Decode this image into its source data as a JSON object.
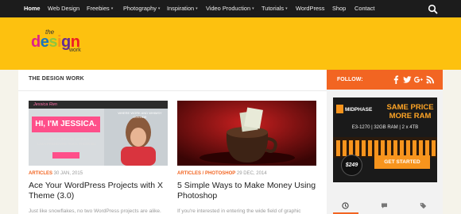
{
  "nav": {
    "items": [
      {
        "label": "Home",
        "caret": false,
        "active": true
      },
      {
        "label": "Web Design",
        "caret": false
      },
      {
        "label": "Freebies",
        "caret": true
      },
      {
        "label": "Photography",
        "caret": true
      },
      {
        "label": "Inspiration",
        "caret": true
      },
      {
        "label": "Video Production",
        "caret": true
      },
      {
        "label": "Tutorials",
        "caret": true
      },
      {
        "label": "WordPress",
        "caret": false
      },
      {
        "label": "Shop",
        "caret": false
      },
      {
        "label": "Contact",
        "caret": false
      }
    ],
    "caret_glyph": "▾",
    "search_icon": "search-icon"
  },
  "logo": {
    "the": "the",
    "design_letters": [
      "d",
      "e",
      "s",
      "i",
      "g",
      "n"
    ],
    "design_colors": [
      "#e0218a",
      "#1b75bb",
      "#8dc63f",
      "#f7941d",
      "#662d91",
      "#ed1c24"
    ],
    "work": "work"
  },
  "section": {
    "title": "THE DESIGN WORK"
  },
  "sidebar": {
    "follow_label": "FOLLOW:",
    "social_icons": [
      "facebook-icon",
      "twitter-icon",
      "google-plus-icon",
      "rss-icon"
    ],
    "ad": {
      "host": "MIDPHASE",
      "headline_lines": [
        "SAME PRICE",
        "MORE RAM"
      ],
      "spec": "E3-1270 | 32GB RAM | 2 x 4TB",
      "price": "$249",
      "cta": "GET STARTED"
    },
    "tabs": [
      {
        "icon": "clock-icon",
        "active": true
      },
      {
        "icon": "comment-icon",
        "active": false
      },
      {
        "icon": "tags-icon",
        "active": false
      }
    ]
  },
  "posts": [
    {
      "category": "ARTICLES",
      "date": "30 JAN, 2015",
      "title": "Ace Your WordPress Projects with X Theme (3.0)",
      "excerpt": "Just like snowflakes, no two WordPress projects are alike.",
      "image": {
        "brand": "Jessica Ren",
        "bubble": "HI, I'M JESSICA.",
        "tag": "I HELP PURPOSE-DRIVEN LADYPRENEURS ROCK THEIR BIZ",
        "tagline": "WHERE WORK AND WHIMSY COLLIDE"
      }
    },
    {
      "category": "ARTICLES",
      "category2": "PHOTOSHOP",
      "date": "29 DEC, 2014",
      "title": "5 Simple Ways to Make Money Using Photoshop",
      "excerpt": "If you're interested in entering the wide field of graphic"
    }
  ],
  "colors": {
    "nav_bg": "#1c1c1c",
    "header": "#fdc10f",
    "accent": "#f26522"
  }
}
